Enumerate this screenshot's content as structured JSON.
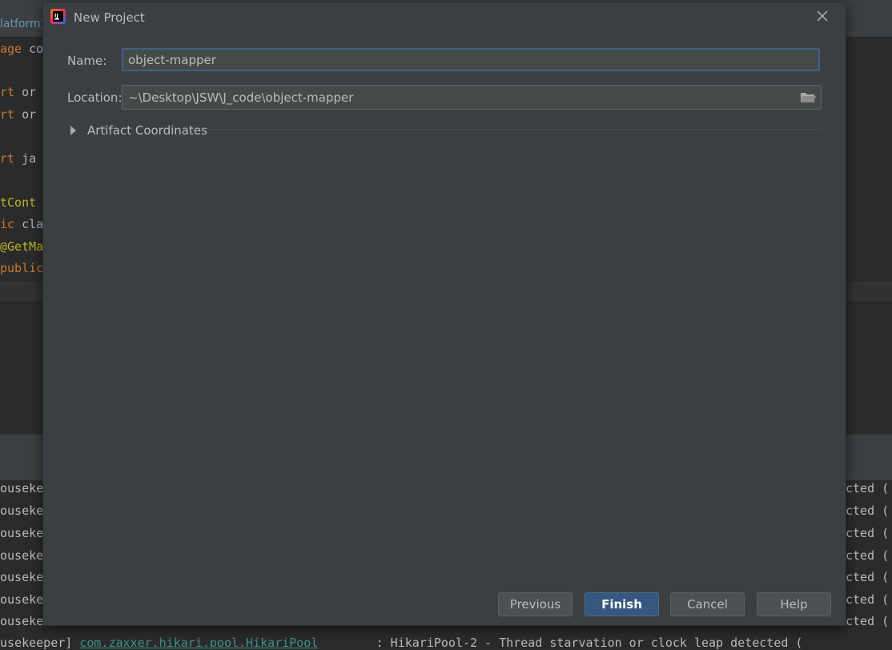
{
  "ide": {
    "tab_text": "latform)",
    "code_lines": [
      {
        "kw": "age",
        "rest": " co",
        "top": 0
      },
      {
        "kw": "rt",
        "rest": " or",
        "top": 0
      },
      {
        "kw": "rt",
        "rest": " or",
        "top": 0
      },
      {
        "kw": "rt",
        "rest": " ja",
        "top": 0
      },
      {
        "ann": "tCont",
        "top": 0
      },
      {
        "kw": "ic",
        "rest": " cla",
        "top": 0
      },
      {
        "ann": "@GetMa",
        "top": 0
      },
      {
        "kw": "public",
        "top": 0
      }
    ],
    "console_left": "ouseke",
    "console_right": "cted (",
    "console_last_prefix": "usekeeper] ",
    "console_last_class": "com.zaxxer.hikari.pool.HikariPool",
    "console_last_message": "        : HikariPool-2 - Thread starvation or clock leap detected ("
  },
  "dialog": {
    "title": "New Project",
    "name_label": "Name:",
    "name_value": "object-mapper",
    "location_label": "Location:",
    "location_value": "~\\Desktop\\JSW\\J_code\\object-mapper",
    "artifact_label": "Artifact Coordinates",
    "buttons": {
      "previous": "Previous",
      "finish": "Finish",
      "cancel": "Cancel",
      "help": "Help"
    }
  },
  "colors": {
    "dialog_bg": "#3c3f41",
    "primary_button": "#365880",
    "focus_border": "#3d6185"
  },
  "icons": [
    "intellij-app-icon",
    "close-icon",
    "folder-icon",
    "chevron-right-icon"
  ]
}
